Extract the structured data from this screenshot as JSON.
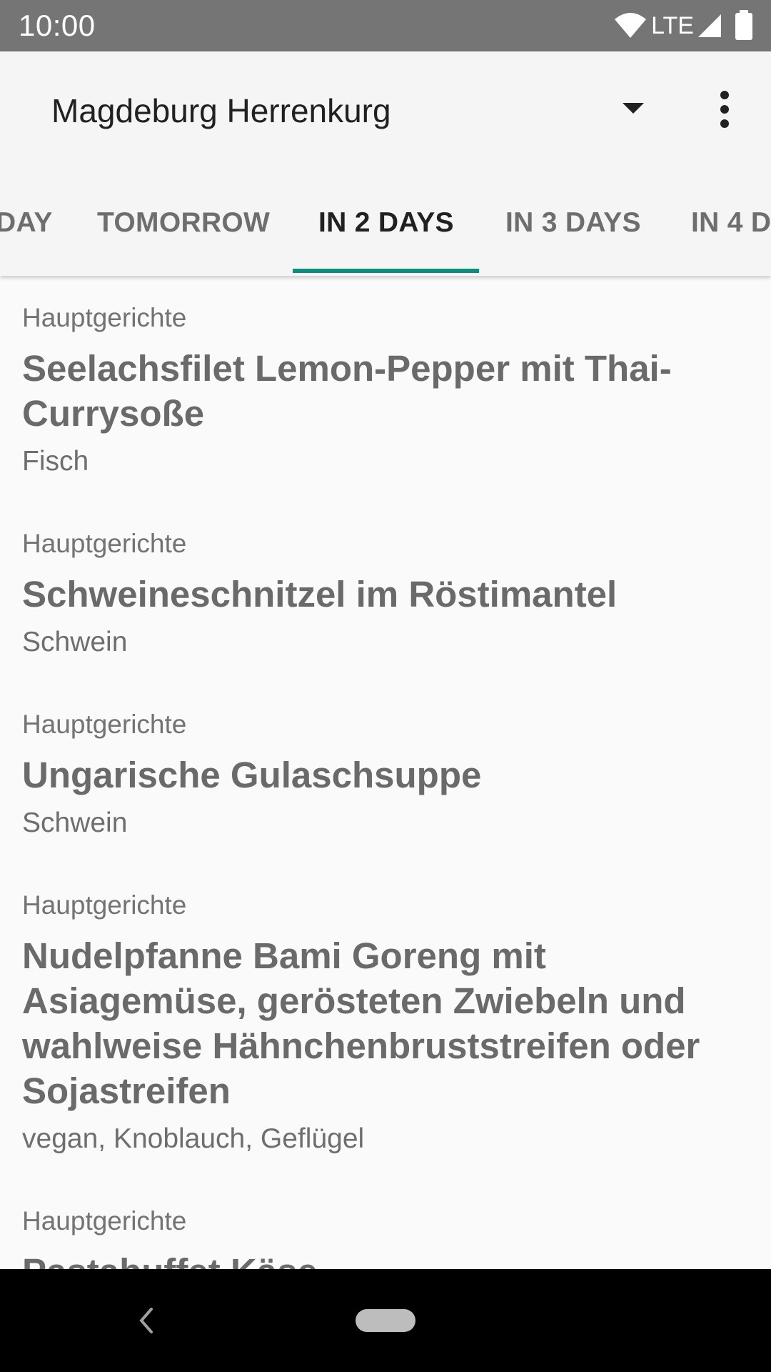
{
  "status_bar": {
    "time": "10:00",
    "network": "LTE",
    "icons": [
      "wifi-icon",
      "signal-icon",
      "battery-icon"
    ]
  },
  "app_bar": {
    "location": "Magdeburg Herrenkurg",
    "icons": [
      "dropdown-arrow-icon",
      "more-vert-icon"
    ]
  },
  "tabs": [
    {
      "label": "TODAY",
      "visible_text": "DAY",
      "active": false
    },
    {
      "label": "TOMORROW",
      "active": false
    },
    {
      "label": "IN 2 DAYS",
      "active": true
    },
    {
      "label": "IN 3 DAYS",
      "active": false
    },
    {
      "label": "IN 4 D",
      "active": false
    }
  ],
  "colors": {
    "accent": "#0f8c7c",
    "status_bar": "#757575",
    "background": "#fafafa"
  },
  "meals": [
    {
      "category": "Hauptgerichte",
      "name": "Seelachsfilet Lemon-Pepper mit Thai-Currysoße",
      "tags": "Fisch"
    },
    {
      "category": "Hauptgerichte",
      "name": "Schweineschnitzel im Röstimantel",
      "tags": "Schwein"
    },
    {
      "category": "Hauptgerichte",
      "name": "Ungarische Gulaschsuppe",
      "tags": "Schwein"
    },
    {
      "category": "Hauptgerichte",
      "name": "Nudelpfanne Bami Goreng mit Asiagemüse, gerösteten Zwiebeln und wahlweise Hähnchenbruststreifen oder Sojastreifen",
      "tags": "vegan, Knoblauch, Geflügel"
    },
    {
      "category": "Hauptgerichte",
      "name": "Pastabuffet Käse",
      "tags": ""
    }
  ],
  "nav_bar": {
    "icons": [
      "back-icon",
      "home-pill"
    ]
  }
}
